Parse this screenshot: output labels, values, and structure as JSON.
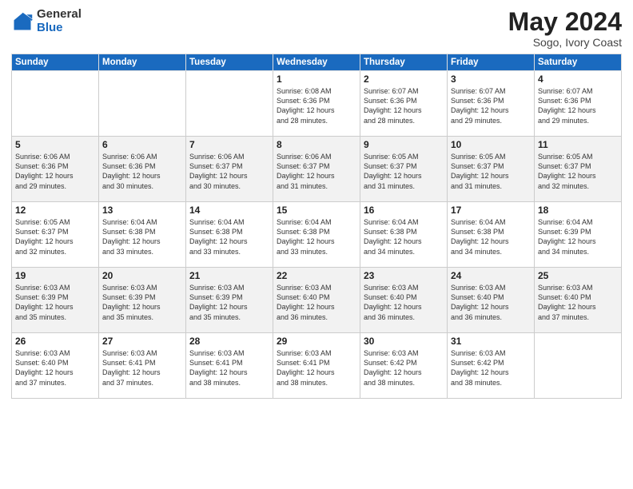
{
  "logo": {
    "general": "General",
    "blue": "Blue"
  },
  "title": "May 2024",
  "subtitle": "Sogo, Ivory Coast",
  "days_header": [
    "Sunday",
    "Monday",
    "Tuesday",
    "Wednesday",
    "Thursday",
    "Friday",
    "Saturday"
  ],
  "weeks": [
    [
      {
        "day": "",
        "info": ""
      },
      {
        "day": "",
        "info": ""
      },
      {
        "day": "",
        "info": ""
      },
      {
        "day": "1",
        "info": "Sunrise: 6:08 AM\nSunset: 6:36 PM\nDaylight: 12 hours\nand 28 minutes."
      },
      {
        "day": "2",
        "info": "Sunrise: 6:07 AM\nSunset: 6:36 PM\nDaylight: 12 hours\nand 28 minutes."
      },
      {
        "day": "3",
        "info": "Sunrise: 6:07 AM\nSunset: 6:36 PM\nDaylight: 12 hours\nand 29 minutes."
      },
      {
        "day": "4",
        "info": "Sunrise: 6:07 AM\nSunset: 6:36 PM\nDaylight: 12 hours\nand 29 minutes."
      }
    ],
    [
      {
        "day": "5",
        "info": "Sunrise: 6:06 AM\nSunset: 6:36 PM\nDaylight: 12 hours\nand 29 minutes."
      },
      {
        "day": "6",
        "info": "Sunrise: 6:06 AM\nSunset: 6:36 PM\nDaylight: 12 hours\nand 30 minutes."
      },
      {
        "day": "7",
        "info": "Sunrise: 6:06 AM\nSunset: 6:37 PM\nDaylight: 12 hours\nand 30 minutes."
      },
      {
        "day": "8",
        "info": "Sunrise: 6:06 AM\nSunset: 6:37 PM\nDaylight: 12 hours\nand 31 minutes."
      },
      {
        "day": "9",
        "info": "Sunrise: 6:05 AM\nSunset: 6:37 PM\nDaylight: 12 hours\nand 31 minutes."
      },
      {
        "day": "10",
        "info": "Sunrise: 6:05 AM\nSunset: 6:37 PM\nDaylight: 12 hours\nand 31 minutes."
      },
      {
        "day": "11",
        "info": "Sunrise: 6:05 AM\nSunset: 6:37 PM\nDaylight: 12 hours\nand 32 minutes."
      }
    ],
    [
      {
        "day": "12",
        "info": "Sunrise: 6:05 AM\nSunset: 6:37 PM\nDaylight: 12 hours\nand 32 minutes."
      },
      {
        "day": "13",
        "info": "Sunrise: 6:04 AM\nSunset: 6:38 PM\nDaylight: 12 hours\nand 33 minutes."
      },
      {
        "day": "14",
        "info": "Sunrise: 6:04 AM\nSunset: 6:38 PM\nDaylight: 12 hours\nand 33 minutes."
      },
      {
        "day": "15",
        "info": "Sunrise: 6:04 AM\nSunset: 6:38 PM\nDaylight: 12 hours\nand 33 minutes."
      },
      {
        "day": "16",
        "info": "Sunrise: 6:04 AM\nSunset: 6:38 PM\nDaylight: 12 hours\nand 34 minutes."
      },
      {
        "day": "17",
        "info": "Sunrise: 6:04 AM\nSunset: 6:38 PM\nDaylight: 12 hours\nand 34 minutes."
      },
      {
        "day": "18",
        "info": "Sunrise: 6:04 AM\nSunset: 6:39 PM\nDaylight: 12 hours\nand 34 minutes."
      }
    ],
    [
      {
        "day": "19",
        "info": "Sunrise: 6:03 AM\nSunset: 6:39 PM\nDaylight: 12 hours\nand 35 minutes."
      },
      {
        "day": "20",
        "info": "Sunrise: 6:03 AM\nSunset: 6:39 PM\nDaylight: 12 hours\nand 35 minutes."
      },
      {
        "day": "21",
        "info": "Sunrise: 6:03 AM\nSunset: 6:39 PM\nDaylight: 12 hours\nand 35 minutes."
      },
      {
        "day": "22",
        "info": "Sunrise: 6:03 AM\nSunset: 6:40 PM\nDaylight: 12 hours\nand 36 minutes."
      },
      {
        "day": "23",
        "info": "Sunrise: 6:03 AM\nSunset: 6:40 PM\nDaylight: 12 hours\nand 36 minutes."
      },
      {
        "day": "24",
        "info": "Sunrise: 6:03 AM\nSunset: 6:40 PM\nDaylight: 12 hours\nand 36 minutes."
      },
      {
        "day": "25",
        "info": "Sunrise: 6:03 AM\nSunset: 6:40 PM\nDaylight: 12 hours\nand 37 minutes."
      }
    ],
    [
      {
        "day": "26",
        "info": "Sunrise: 6:03 AM\nSunset: 6:40 PM\nDaylight: 12 hours\nand 37 minutes."
      },
      {
        "day": "27",
        "info": "Sunrise: 6:03 AM\nSunset: 6:41 PM\nDaylight: 12 hours\nand 37 minutes."
      },
      {
        "day": "28",
        "info": "Sunrise: 6:03 AM\nSunset: 6:41 PM\nDaylight: 12 hours\nand 38 minutes."
      },
      {
        "day": "29",
        "info": "Sunrise: 6:03 AM\nSunset: 6:41 PM\nDaylight: 12 hours\nand 38 minutes."
      },
      {
        "day": "30",
        "info": "Sunrise: 6:03 AM\nSunset: 6:42 PM\nDaylight: 12 hours\nand 38 minutes."
      },
      {
        "day": "31",
        "info": "Sunrise: 6:03 AM\nSunset: 6:42 PM\nDaylight: 12 hours\nand 38 minutes."
      },
      {
        "day": "",
        "info": ""
      }
    ]
  ]
}
